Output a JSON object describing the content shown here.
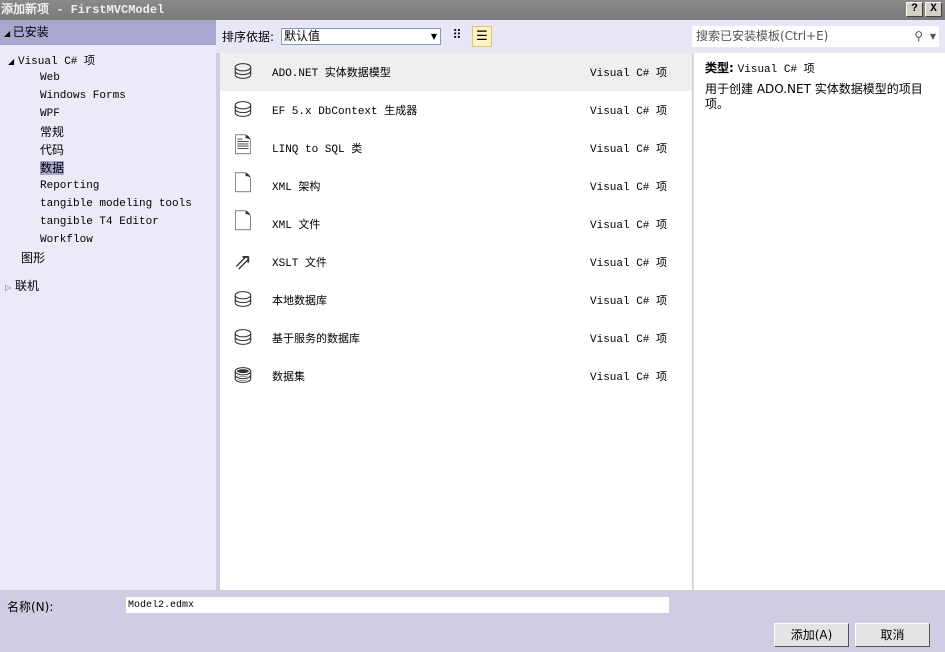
{
  "window": {
    "title": "添加新项 - FirstMVCModel",
    "help": "?",
    "close": "X"
  },
  "left": {
    "header": "已安装",
    "tree": [
      {
        "label": "Visual C# 项",
        "arrow": "◢"
      },
      {
        "label": "Web"
      },
      {
        "label": "Windows Forms"
      },
      {
        "label": "WPF"
      },
      {
        "label": "常规"
      },
      {
        "label": "代码"
      },
      {
        "label": "数据"
      },
      {
        "label": "Reporting"
      },
      {
        "label": "tangible modeling tools"
      },
      {
        "label": "tangible T4 Editor"
      },
      {
        "label": "Workflow"
      },
      {
        "label": "图形"
      },
      {
        "label": "联机",
        "arrow": "▷"
      }
    ]
  },
  "toolbar": {
    "sort_label": "排序依据:",
    "sort_value": "默认值",
    "search_placeholder": "搜索已安装模板(Ctrl+E)"
  },
  "items": [
    {
      "name": "ADO.NET 实体数据模型",
      "type": "Visual C# 项",
      "icon": "entity-model-icon"
    },
    {
      "name": "EF 5.x DbContext 生成器",
      "type": "Visual C# 项",
      "icon": "dbcontext-generator-icon"
    },
    {
      "name": "LINQ to SQL 类",
      "type": "Visual C# 项",
      "icon": "linq-to-sql-icon"
    },
    {
      "name": "XML 架构",
      "type": "Visual C# 项",
      "icon": "xml-schema-icon"
    },
    {
      "name": "XML 文件",
      "type": "Visual C# 项",
      "icon": "xml-file-icon"
    },
    {
      "name": "XSLT 文件",
      "type": "Visual C# 项",
      "icon": "xslt-file-icon"
    },
    {
      "name": "本地数据库",
      "type": "Visual C# 项",
      "icon": "database-icon"
    },
    {
      "name": "基于服务的数据库",
      "type": "Visual C# 项",
      "icon": "database-icon"
    },
    {
      "name": "数据集",
      "type": "Visual C# 项",
      "icon": "dataset-icon"
    }
  ],
  "detail": {
    "type_label": "类型:",
    "type_value": "Visual C# 项",
    "description": "用于创建 ADO.NET 实体数据模型的项目项。"
  },
  "bottom": {
    "name_label": "名称(N):",
    "name_value": "Model2.edmx",
    "add": "添加(A)",
    "cancel": "取消"
  }
}
